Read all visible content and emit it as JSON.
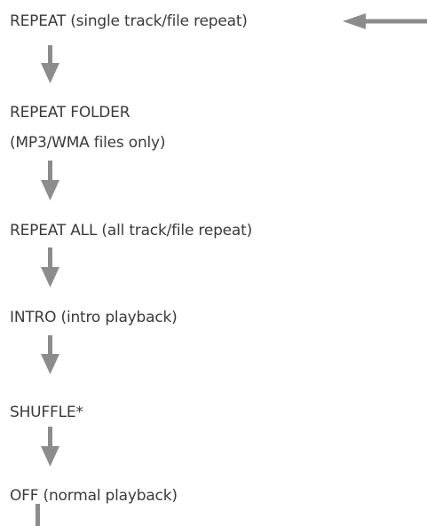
{
  "steps": [
    "REPEAT (single track/file repeat)",
    "REPEAT FOLDER",
    "(MP3/WMA files only)",
    "REPEAT ALL (all track/file repeat)",
    "INTRO (intro playback)",
    "SHUFFLE*",
    "OFF (normal playback)"
  ],
  "colors": {
    "text": "#3a3a3a",
    "arrow": "#8c8c8c"
  }
}
